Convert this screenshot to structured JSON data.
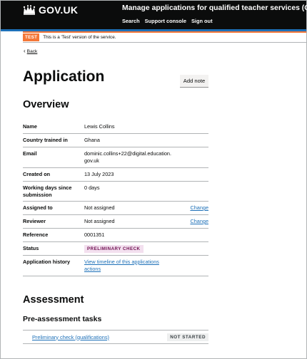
{
  "header": {
    "logo_text": "GOV.UK",
    "service_name": "Manage applications for qualified teacher services (QTS)",
    "nav": [
      "Search",
      "Support console",
      "Sign out"
    ]
  },
  "phase_banner": {
    "tag": "TEST",
    "text": "This is a 'Test' version of the service."
  },
  "back_link": "Back",
  "page_title": "Application",
  "add_note_button": "Add note",
  "overview": {
    "heading": "Overview",
    "rows": [
      {
        "key": "Name",
        "value": "Lewis Collins"
      },
      {
        "key": "Country trained in",
        "value": "Ghana"
      },
      {
        "key": "Email",
        "value": "dominic.collins+22@digital.education.gov.uk"
      },
      {
        "key": "Created on",
        "value": "13 July 2023"
      },
      {
        "key": "Working days since submission",
        "value": "0 days"
      },
      {
        "key": "Assigned to",
        "value": "Not assigned",
        "action": "Change"
      },
      {
        "key": "Reviewer",
        "value": "Not assigned",
        "action": "Change"
      },
      {
        "key": "Reference",
        "value": "0001351"
      },
      {
        "key": "Status",
        "tag": "PRELIMINARY CHECK"
      },
      {
        "key": "Application history",
        "link": "View timeline of this applications actions"
      }
    ]
  },
  "assessment": {
    "heading": "Assessment",
    "subheading": "Pre-assessment tasks",
    "task": {
      "label": "Preliminary check (qualifications)",
      "status": "NOT STARTED"
    }
  },
  "colors": {
    "header": "#0b0c0c",
    "brand_blue": "#1d70b8",
    "phase_orange": "#f47738",
    "link": "#1d70b8",
    "tag_pink_bg": "#f3e0ef",
    "tag_pink_text": "#6f0f50"
  }
}
